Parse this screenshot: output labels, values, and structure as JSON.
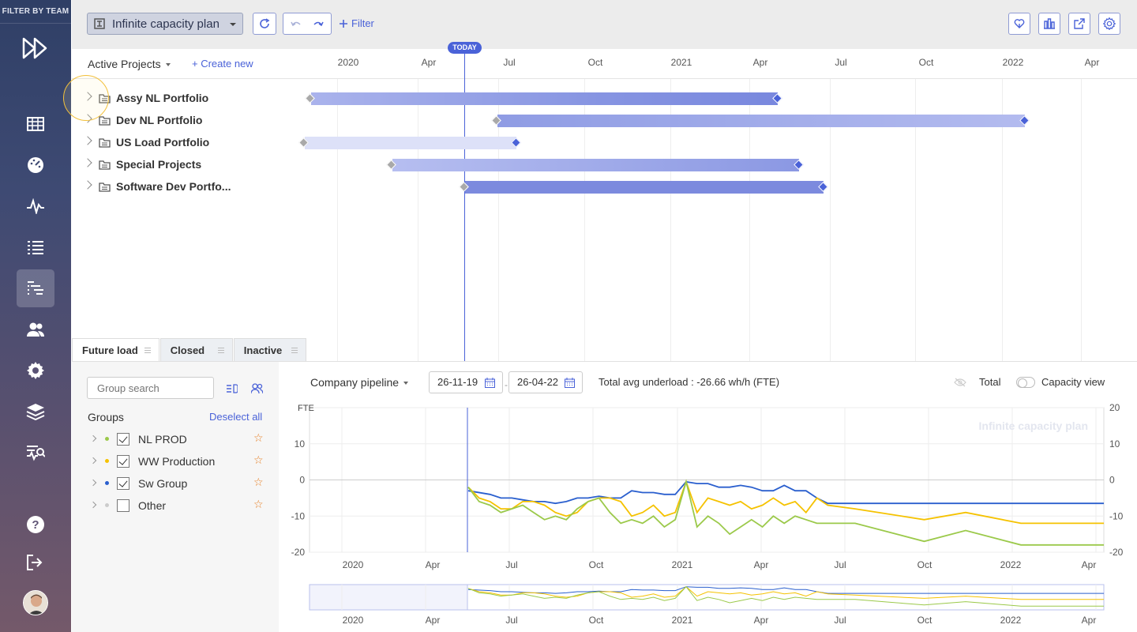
{
  "sidebar": {
    "filter_label": "FILTER BY TEAM",
    "icons": [
      "logo-icon",
      "grid-icon",
      "dashboard-icon",
      "activity-icon",
      "list-icon",
      "gantt-icon",
      "users-icon",
      "settings-icon",
      "layers-icon",
      "analytics-icon",
      "help-icon",
      "logout-icon"
    ],
    "active_item": "gantt-icon"
  },
  "toolbar": {
    "plan_name": "Infinite capacity plan",
    "filter_label": "Filter"
  },
  "gantt": {
    "column_title": "Active Projects",
    "create_new": "Create new",
    "today_label": "TODAY",
    "timeline_ticks": [
      "2020",
      "Apr",
      "Jul",
      "Oct",
      "2021",
      "Apr",
      "Jul",
      "Oct",
      "2022",
      "Apr"
    ],
    "projects": [
      {
        "name": "Assy NL Portfolio"
      },
      {
        "name": "Dev NL Portfolio"
      },
      {
        "name": "US Load Portfolio"
      },
      {
        "name": "Special Projects"
      },
      {
        "name": "Software Dev Portfo..."
      }
    ]
  },
  "tabs": [
    {
      "label": "Future load",
      "active": true
    },
    {
      "label": "Closed",
      "active": false
    },
    {
      "label": "Inactive",
      "active": false
    }
  ],
  "groups_panel": {
    "search_placeholder": "Group search",
    "title": "Groups",
    "deselect_all": "Deselect all",
    "groups": [
      {
        "name": "NL PROD",
        "checked": true,
        "color": "#9bc94a"
      },
      {
        "name": "WW Production",
        "checked": true,
        "color": "#f5c200"
      },
      {
        "name": "Sw Group",
        "checked": true,
        "color": "#2a5fce"
      },
      {
        "name": "Other",
        "checked": false,
        "color": "#cccccc"
      }
    ]
  },
  "chart_controls": {
    "pipeline": "Company pipeline",
    "date_from": "26-11-19",
    "date_sep": "-",
    "date_to": "26-04-22",
    "avg_text": "Total avg underload : -26.66 wh/h (FTE)",
    "total_label": "Total",
    "capacity_view_label": "Capacity view"
  },
  "chart_data": {
    "type": "line",
    "watermark": "Infinite capacity plan",
    "ylabel": "FTE",
    "ylim": [
      -20,
      20
    ],
    "y_ticks_left": [
      "10",
      "0",
      "-10",
      "-20"
    ],
    "y_ticks_right": [
      "20",
      "10",
      "0",
      "-10",
      "-20"
    ],
    "x_ticks": [
      "2020",
      "Apr",
      "Jul",
      "Oct",
      "2021",
      "Apr",
      "Jul",
      "Oct",
      "2022",
      "Apr"
    ],
    "series": [
      {
        "color": "#2a5fce",
        "values": [
          [
            0,
            -3
          ],
          [
            2,
            -4
          ],
          [
            3,
            -5
          ],
          [
            4,
            -5
          ],
          [
            5,
            -5.5
          ],
          [
            6,
            -6
          ],
          [
            7,
            -6
          ],
          [
            8,
            -6.5
          ],
          [
            9,
            -6
          ],
          [
            10,
            -5
          ],
          [
            11,
            -5
          ],
          [
            12,
            -4.5
          ],
          [
            13,
            -5
          ],
          [
            14,
            -5
          ],
          [
            15,
            -3
          ],
          [
            16,
            -3.5
          ],
          [
            17,
            -3.5
          ],
          [
            18,
            -4
          ],
          [
            19,
            -4
          ],
          [
            20,
            -0.5
          ],
          [
            21,
            -1
          ],
          [
            22,
            -1
          ],
          [
            23,
            -2
          ],
          [
            24,
            -2
          ],
          [
            25,
            -1.5
          ],
          [
            26,
            -2
          ],
          [
            27,
            -3
          ],
          [
            28,
            -3
          ],
          [
            29,
            -1.5
          ],
          [
            30,
            -3
          ],
          [
            31,
            -3
          ],
          [
            32,
            -5
          ],
          [
            33,
            -6.5
          ],
          [
            35,
            -6.5
          ],
          [
            40,
            -6.5
          ],
          [
            45,
            -6.5
          ],
          [
            50,
            -6.5
          ],
          [
            53,
            -6.5
          ]
        ]
      },
      {
        "color": "#f5c200",
        "values": [
          [
            0,
            -2
          ],
          [
            1,
            -5
          ],
          [
            2,
            -6
          ],
          [
            3,
            -8
          ],
          [
            4,
            -8
          ],
          [
            5,
            -6
          ],
          [
            6,
            -6
          ],
          [
            7,
            -7
          ],
          [
            8,
            -9
          ],
          [
            9,
            -10
          ],
          [
            10,
            -9
          ],
          [
            11,
            -6
          ],
          [
            12,
            -5
          ],
          [
            13,
            -5
          ],
          [
            14,
            -6
          ],
          [
            15,
            -10
          ],
          [
            16,
            -9
          ],
          [
            17,
            -7
          ],
          [
            18,
            -10
          ],
          [
            19,
            -9
          ],
          [
            20,
            -0.5
          ],
          [
            21,
            -9
          ],
          [
            22,
            -5
          ],
          [
            23,
            -6
          ],
          [
            24,
            -7
          ],
          [
            25,
            -6
          ],
          [
            26,
            -8
          ],
          [
            27,
            -7
          ],
          [
            28,
            -5
          ],
          [
            29,
            -7
          ],
          [
            30,
            -6
          ],
          [
            31,
            -9
          ],
          [
            32,
            -5
          ],
          [
            33,
            -7
          ],
          [
            35,
            -8
          ],
          [
            40,
            -11
          ],
          [
            43,
            -9
          ],
          [
            47,
            -12
          ],
          [
            50,
            -12
          ],
          [
            53,
            -12
          ]
        ]
      },
      {
        "color": "#9bc94a",
        "values": [
          [
            0,
            -2
          ],
          [
            1,
            -6
          ],
          [
            2,
            -7
          ],
          [
            3,
            -9
          ],
          [
            4,
            -8
          ],
          [
            5,
            -7
          ],
          [
            6,
            -9
          ],
          [
            7,
            -11
          ],
          [
            8,
            -10
          ],
          [
            9,
            -11
          ],
          [
            10,
            -8
          ],
          [
            11,
            -6
          ],
          [
            12,
            -5
          ],
          [
            13,
            -9
          ],
          [
            14,
            -12
          ],
          [
            15,
            -11
          ],
          [
            16,
            -12
          ],
          [
            17,
            -10
          ],
          [
            18,
            -13
          ],
          [
            19,
            -11
          ],
          [
            20,
            -0.5
          ],
          [
            21,
            -13
          ],
          [
            22,
            -10
          ],
          [
            23,
            -12
          ],
          [
            24,
            -15
          ],
          [
            25,
            -13
          ],
          [
            26,
            -11
          ],
          [
            27,
            -13
          ],
          [
            28,
            -10
          ],
          [
            29,
            -12
          ],
          [
            30,
            -10
          ],
          [
            31,
            -11
          ],
          [
            32,
            -12
          ],
          [
            33,
            -12
          ],
          [
            35,
            -12
          ],
          [
            40,
            -17
          ],
          [
            43,
            -14
          ],
          [
            47,
            -18
          ],
          [
            50,
            -18
          ],
          [
            53,
            -18
          ]
        ]
      }
    ]
  }
}
